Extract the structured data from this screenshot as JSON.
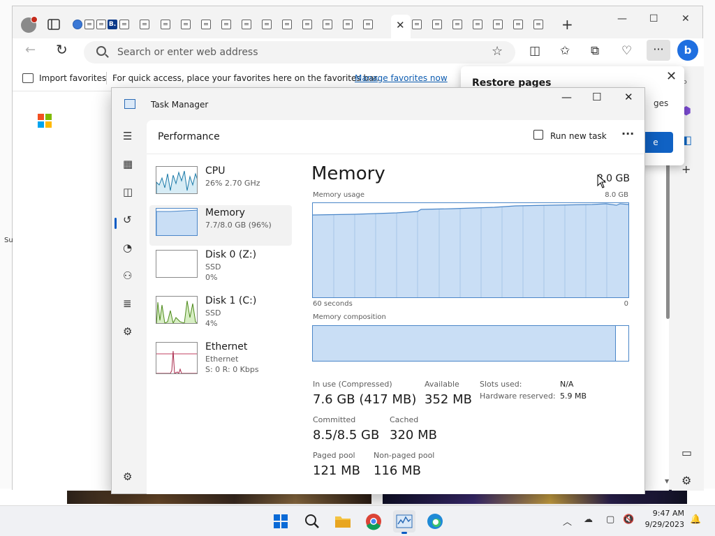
{
  "browser": {
    "address_placeholder": "Search or enter web address",
    "favorites": {
      "import_label": "Import favorites",
      "message": "For quick access, place your favorites here on the favorites bar.",
      "manage_link": "Manage favorites now"
    },
    "tab_badge": "B.",
    "side_text": "Su",
    "restore_popup": {
      "title": "Restore pages",
      "text_fragment": "ges",
      "button_fragment": "e"
    }
  },
  "task_manager": {
    "title": "Task Manager",
    "section": "Performance",
    "run_new_task": "Run new task",
    "more": "···",
    "resources": [
      {
        "name": "CPU",
        "sub": "26%  2.70 GHz",
        "sub2": ""
      },
      {
        "name": "Memory",
        "sub": "7.7/8.0 GB (96%)",
        "sub2": ""
      },
      {
        "name": "Disk 0 (Z:)",
        "sub": "SSD",
        "sub2": "0%"
      },
      {
        "name": "Disk 1 (C:)",
        "sub": "SSD",
        "sub2": "4%"
      },
      {
        "name": "Ethernet",
        "sub": "Ethernet",
        "sub2": "S: 0  R: 0 Kbps"
      }
    ],
    "memory": {
      "heading": "Memory",
      "total": "8.0 GB",
      "usage_label": "Memory usage",
      "usage_max": "8.0 GB",
      "axis_left": "60 seconds",
      "axis_right": "0",
      "composition_label": "Memory composition",
      "composition_used_fraction": 0.96,
      "in_use_label": "In use (Compressed)",
      "in_use_value": "7.6 GB (417 MB)",
      "available_label": "Available",
      "available_value": "352 MB",
      "committed_label": "Committed",
      "committed_value": "8.5/8.5 GB",
      "cached_label": "Cached",
      "cached_value": "320 MB",
      "paged_label": "Paged pool",
      "paged_value": "121 MB",
      "nonpaged_label": "Non-paged pool",
      "nonpaged_value": "116 MB",
      "slots_label": "Slots used:",
      "slots_value": "N/A",
      "hw_label": "Hardware reserved:",
      "hw_value": "5.9 MB"
    }
  },
  "taskbar": {
    "time": "9:47 AM",
    "date": "9/29/2023"
  },
  "colors": {
    "accent": "#0a5bc4",
    "memory_fill": "#c9def5",
    "memory_line": "#4a86c8"
  }
}
